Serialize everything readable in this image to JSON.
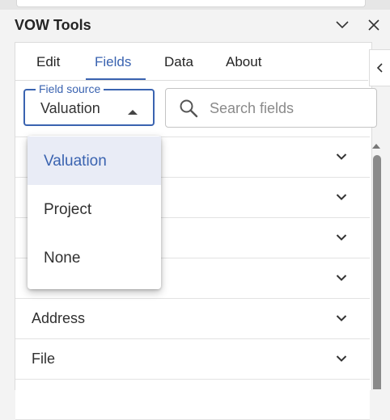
{
  "app": {
    "title": "VOW Tools"
  },
  "titlebar": {
    "dropdown_icon": "chevron-down-icon",
    "close_icon": "close-icon"
  },
  "tabs": [
    {
      "label": "Edit",
      "active": false
    },
    {
      "label": "Fields",
      "active": true
    },
    {
      "label": "Data",
      "active": false
    },
    {
      "label": "About",
      "active": false
    }
  ],
  "field_source": {
    "label": "Field source",
    "value": "Valuation",
    "options": [
      {
        "label": "Valuation",
        "selected": true
      },
      {
        "label": "Project",
        "selected": false
      },
      {
        "label": "None",
        "selected": false
      }
    ]
  },
  "search": {
    "placeholder": "Search fields",
    "value": ""
  },
  "field_groups": [
    {
      "label": ""
    },
    {
      "label": ""
    },
    {
      "label": ""
    },
    {
      "label": ""
    },
    {
      "label": "Address"
    },
    {
      "label": "File"
    },
    {
      "label": ""
    }
  ],
  "colors": {
    "accent": "#3a63b0",
    "selected_bg": "#e9ecf6",
    "panel_bg": "#ffffff",
    "window_bg": "#f3f3f3"
  }
}
